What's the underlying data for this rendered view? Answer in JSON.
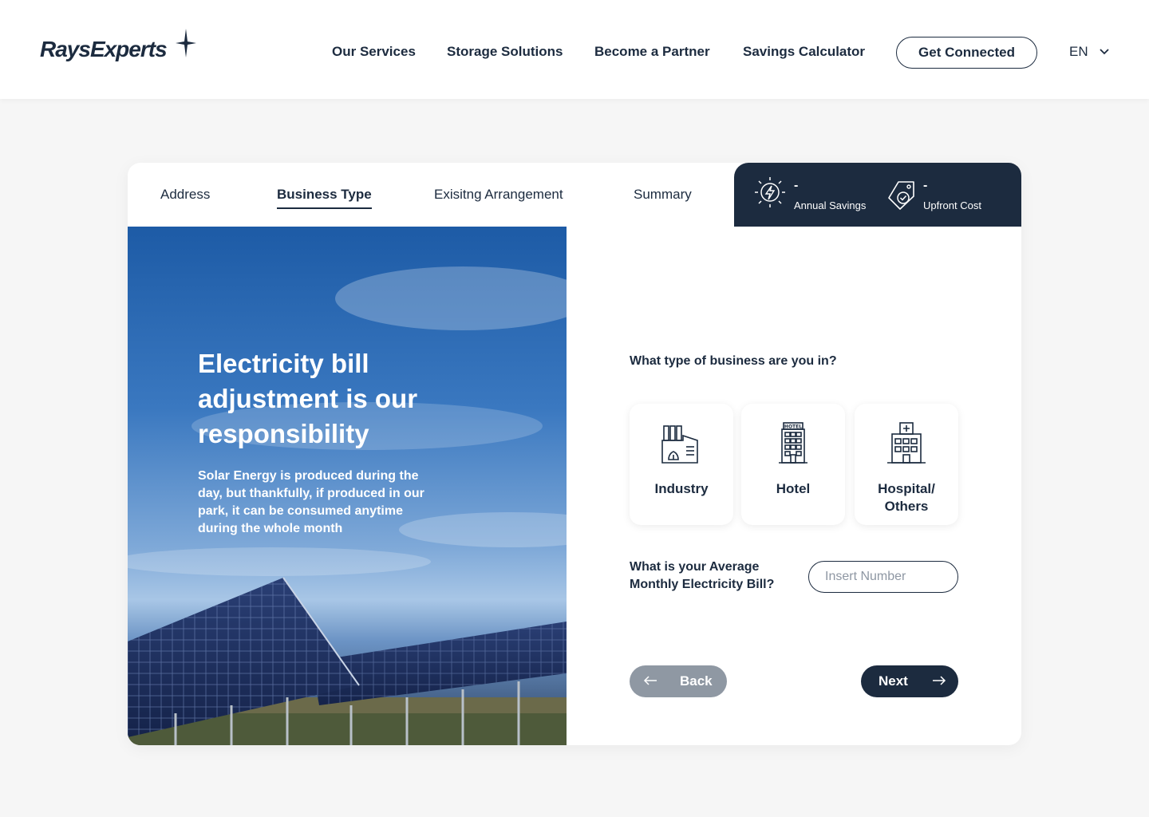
{
  "header": {
    "logo_text": "RaysExperts",
    "nav": [
      "Our Services",
      "Storage Solutions",
      "Become a Partner",
      "Savings Calculator"
    ],
    "cta_label": "Get Connected",
    "language": "EN"
  },
  "steps": {
    "tabs": [
      "Address",
      "Business Type",
      "Exisitng Arrangement",
      "Summary"
    ],
    "active": "Business Type"
  },
  "stats": {
    "annual_savings_value": "-",
    "annual_savings_label": "Annual Savings",
    "upfront_cost_value": "-",
    "upfront_cost_label": "Upfront Cost"
  },
  "hero": {
    "title": "Electricity bill adjustment is our responsibility",
    "subtitle": "Solar Energy is produced during the day, but thankfully, if produced in our park, it can be consumed anytime during the whole month"
  },
  "form": {
    "business_question": "What type of business are you in?",
    "business_types": [
      {
        "label": "Industry",
        "icon": "factory-icon"
      },
      {
        "label": "Hotel",
        "icon": "hotel-icon"
      },
      {
        "label": "Hospital/ Others",
        "icon": "hospital-icon"
      }
    ],
    "bill_question": "What is your Average Monthly Electricity Bill?",
    "bill_placeholder": "Insert Number",
    "back_label": "Back",
    "next_label": "Next"
  },
  "colors": {
    "navy": "#1c2b3f",
    "grey_button": "#8f98a3",
    "background": "#f6f6f6"
  }
}
